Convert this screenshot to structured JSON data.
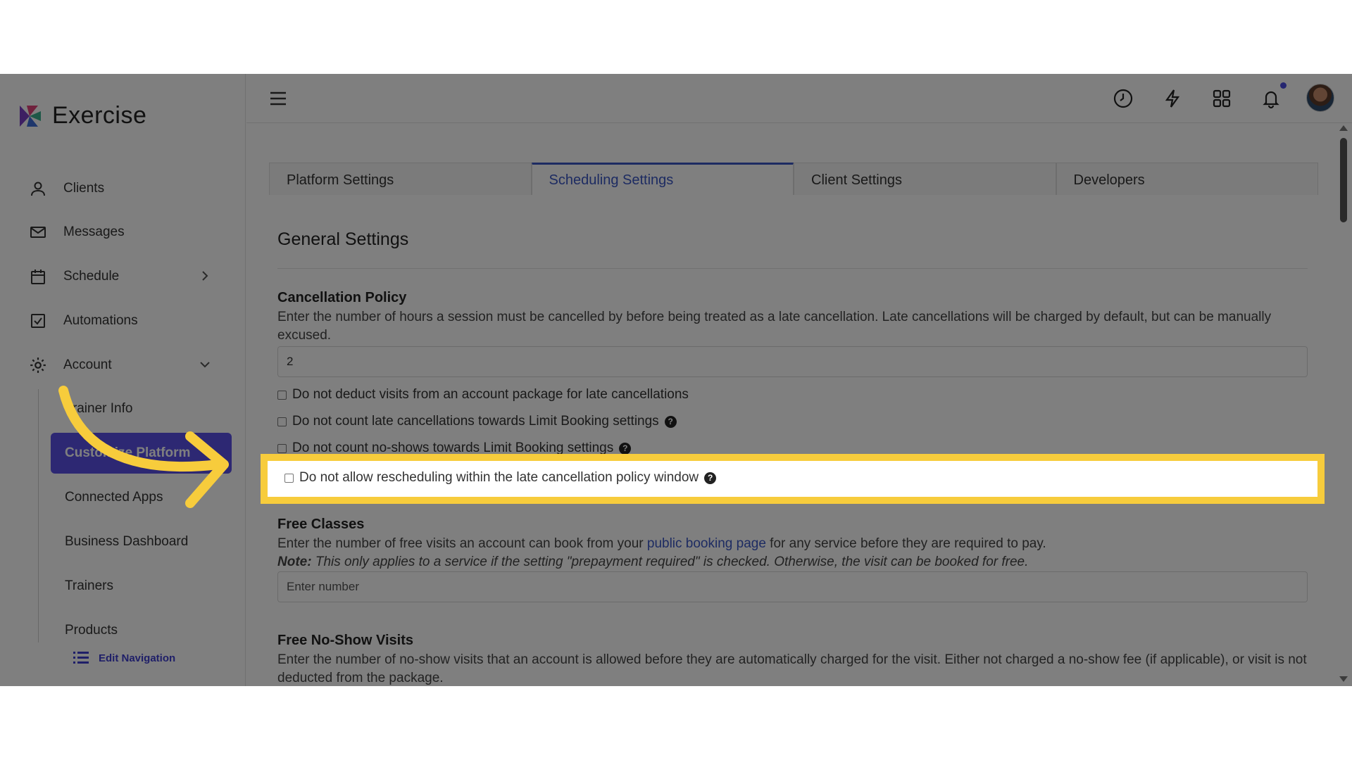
{
  "app": {
    "name": "Exercise"
  },
  "sidebar": {
    "items": [
      {
        "label": "Clients",
        "icon": "person-icon"
      },
      {
        "label": "Messages",
        "icon": "envelope-icon"
      },
      {
        "label": "Schedule",
        "icon": "calendar-icon"
      },
      {
        "label": "Automations",
        "icon": "checkbox-icon"
      },
      {
        "label": "Account",
        "icon": "gear-icon"
      }
    ],
    "account_submenu": [
      {
        "label": "Trainer Info"
      },
      {
        "label": "Customize Platform",
        "active": true
      },
      {
        "label": "Connected Apps"
      },
      {
        "label": "Business Dashboard"
      },
      {
        "label": "Trainers"
      },
      {
        "label": "Products"
      }
    ],
    "edit_navigation": "Edit Navigation"
  },
  "topbar": {
    "icons": [
      "menu-icon",
      "clock-icon",
      "lightning-icon",
      "apps-grid-icon",
      "bell-icon",
      "avatar"
    ]
  },
  "tabs": [
    {
      "label": "Platform Settings"
    },
    {
      "label": "Scheduling Settings",
      "active": true
    },
    {
      "label": "Client Settings"
    },
    {
      "label": "Developers"
    }
  ],
  "general": {
    "title": "General Settings",
    "cancellation": {
      "label": "Cancellation Policy",
      "description": "Enter the number of hours a session must be cancelled by before being treated as a late cancellation. Late cancellations will be charged by default, but can be manually excused.",
      "value": "2",
      "checkboxes": [
        {
          "label": "Do not deduct visits from an account package for late cancellations",
          "checked": false,
          "help": false
        },
        {
          "label": "Do not count late cancellations towards Limit Booking settings",
          "checked": false,
          "help": true
        },
        {
          "label": "Do not count no-shows towards Limit Booking settings",
          "checked": false,
          "help": true
        },
        {
          "label": "Do not allow rescheduling within the late cancellation policy window",
          "checked": false,
          "help": true
        }
      ]
    },
    "free_classes": {
      "label": "Free Classes",
      "description_pre": "Enter the number of free visits an account can book from your ",
      "link": "public booking page",
      "description_post": " for any service before they are required to pay.",
      "note_label": "Note:",
      "note": " This only applies to a service if the setting \"prepayment required\" is checked. Otherwise, the visit can be booked for free.",
      "placeholder": "Enter number"
    },
    "free_no_show": {
      "label": "Free No-Show Visits",
      "description": "Enter the number of no-show visits that an account is allowed before they are automatically charged for the visit. Either not charged a no-show fee (if applicable), or visit is not deducted from the package."
    }
  },
  "colors": {
    "accent": "#5a50e6",
    "highlight": "#f7cc3c",
    "link": "#3a57c4"
  }
}
